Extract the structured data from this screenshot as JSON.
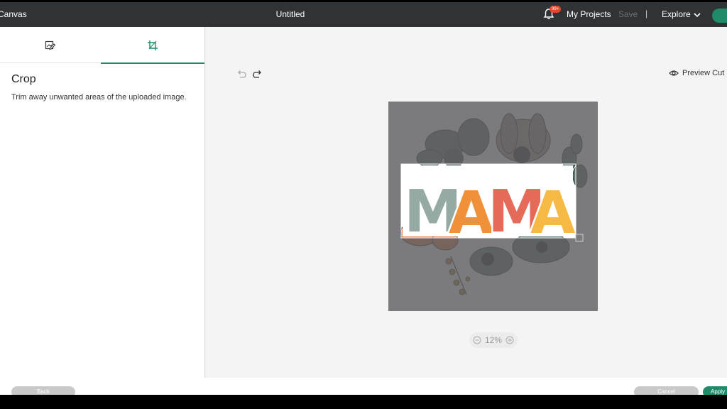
{
  "header": {
    "app_title": "Canvas",
    "document_title": "Untitled",
    "notification_badge": "99+",
    "my_projects_label": "My Projects",
    "save_label": "Save",
    "separator": "|",
    "explore_label": "Explore"
  },
  "panel": {
    "tabs": [
      {
        "icon": "edit-image-icon",
        "active": false
      },
      {
        "icon": "crop-icon",
        "active": true
      }
    ],
    "title": "Crop",
    "description": "Trim away unwanted areas of the uploaded image."
  },
  "canvas": {
    "preview_label": "Preview Cut",
    "zoom_level": "12%",
    "artwork_text": "MAMA"
  },
  "footer": {
    "back_label": "Back",
    "cancel_label": "Cancel",
    "apply_label": "Apply"
  },
  "colors": {
    "topbar": "#2f3335",
    "accent": "#1f8b6a",
    "overlay": "#6b6a6c",
    "letter_1": "#94aaa2",
    "letter_2": "#f0913a",
    "letter_3": "#e56a57",
    "letter_4": "#f5b944"
  }
}
